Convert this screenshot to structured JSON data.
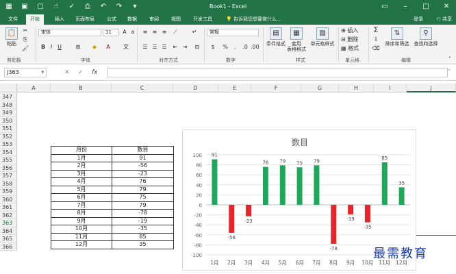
{
  "app": {
    "window_title": "Book1 - Excel",
    "sign_in": "登录",
    "share": "共享",
    "tell_me": "告诉我您想要做什么..."
  },
  "tabs": [
    "文件",
    "开始",
    "插入",
    "页面布局",
    "公式",
    "数据",
    "审阅",
    "视图",
    "开发工具"
  ],
  "active_tab": "开始",
  "ribbon": {
    "clipboard": {
      "label": "剪贴板",
      "paste": "粘贴"
    },
    "font": {
      "label": "字体",
      "font_name": "宋体",
      "font_size": "11",
      "bold": "B",
      "italic": "I",
      "underline": "U"
    },
    "alignment": {
      "label": "对齐方式"
    },
    "number": {
      "label": "数字",
      "format": "常规",
      "percent": "%"
    },
    "styles": {
      "label": "样式",
      "conditional": "条件格式",
      "table": "套用\n表格格式",
      "cell_styles": "单元格样式"
    },
    "cells": {
      "label": "单元格",
      "insert": "插入",
      "delete": "删除",
      "format": "格式"
    },
    "editing": {
      "label": "编辑",
      "sum": "Σ",
      "sort": "排序和筛选",
      "find": "查找和选择"
    }
  },
  "formula_bar": {
    "name_box": "J363",
    "fx": "fx",
    "value": ""
  },
  "columns": [
    "A",
    "B",
    "C",
    "D",
    "E",
    "F",
    "G",
    "H",
    "I",
    "J"
  ],
  "rows": [
    "347",
    "348",
    "349",
    "350",
    "351",
    "352",
    "353",
    "354",
    "355",
    "356",
    "357",
    "358",
    "359",
    "360",
    "361",
    "362",
    "363",
    "364",
    "365",
    "366"
  ],
  "selected_row": "363",
  "table": {
    "headers": [
      "月份",
      "数目"
    ],
    "rows": [
      [
        "1月",
        "91"
      ],
      [
        "2月",
        "-56"
      ],
      [
        "3月",
        "-23"
      ],
      [
        "4月",
        "76"
      ],
      [
        "5月",
        "79"
      ],
      [
        "6月",
        "75"
      ],
      [
        "7月",
        "79"
      ],
      [
        "8月",
        "-78"
      ],
      [
        "9月",
        "-19"
      ],
      [
        "10月",
        "-35"
      ],
      [
        "11月",
        "85"
      ],
      [
        "12月",
        "35"
      ]
    ]
  },
  "chart_data": {
    "type": "bar",
    "title": "数目",
    "categories": [
      "1月",
      "2月",
      "3月",
      "4月",
      "5月",
      "6月",
      "7月",
      "8月",
      "9月",
      "10月",
      "11月",
      "12月"
    ],
    "values": [
      91,
      -56,
      -23,
      76,
      79,
      75,
      79,
      -78,
      -19,
      -35,
      85,
      35
    ],
    "ylim": [
      -100,
      100
    ],
    "yticks": [
      -100,
      -80,
      -60,
      -40,
      -20,
      0,
      20,
      40,
      60,
      80,
      100
    ],
    "grid": true,
    "positive_color": "#1ea85a",
    "negative_color": "#e8232a"
  },
  "watermark": "最需教育",
  "colors": {
    "excel_green": "#217346"
  }
}
